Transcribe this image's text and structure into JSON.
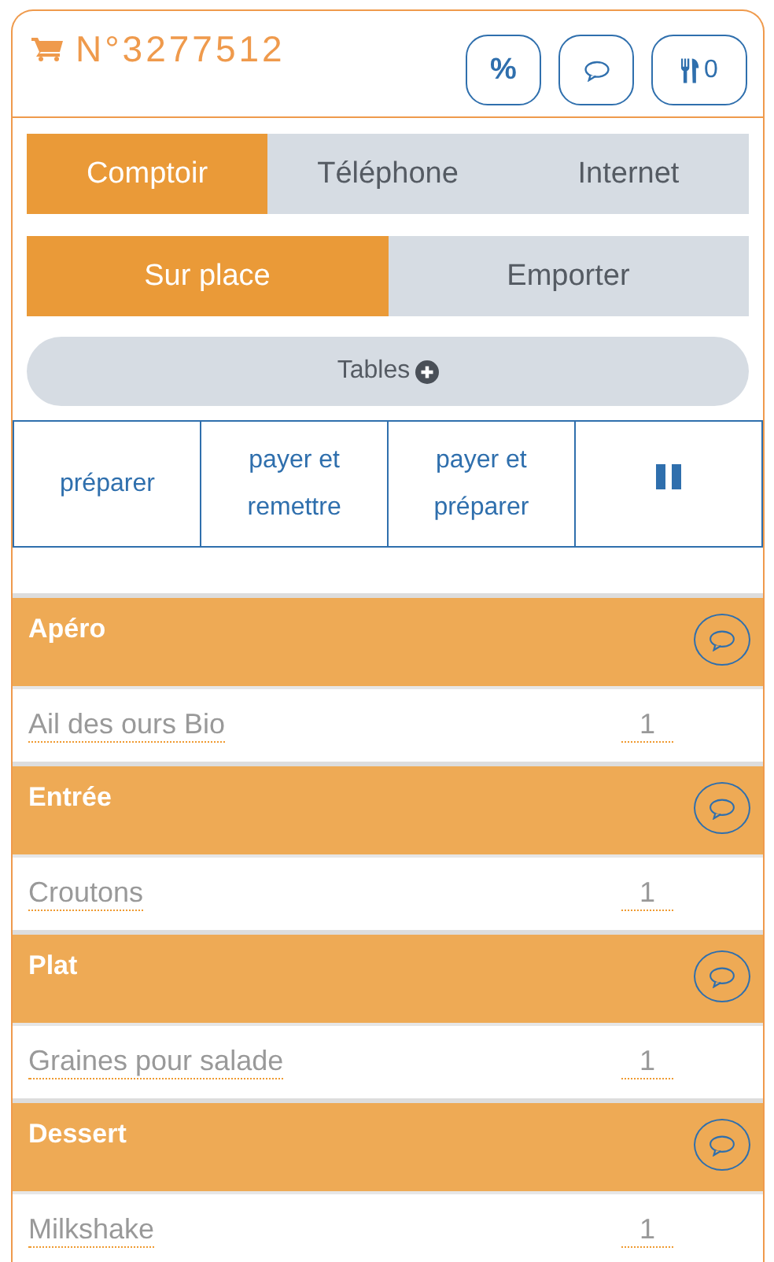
{
  "order": {
    "number": "N°3277512"
  },
  "header_buttons": [
    {
      "kind": "percent",
      "label": "%"
    },
    {
      "kind": "comment"
    },
    {
      "kind": "cutlery",
      "count": "0"
    }
  ],
  "channels": [
    {
      "label": "Comptoir",
      "selected": true
    },
    {
      "label": "Téléphone",
      "selected": false
    },
    {
      "label": "Internet",
      "selected": false
    }
  ],
  "modes": [
    {
      "label": "Sur place",
      "selected": true
    },
    {
      "label": "Emporter",
      "selected": false
    }
  ],
  "tables_button": {
    "label": "Tables"
  },
  "actions": [
    {
      "kind": "text",
      "label": "préparer"
    },
    {
      "kind": "text",
      "label": "payer et remettre"
    },
    {
      "kind": "text",
      "label": "payer et préparer"
    },
    {
      "kind": "pause"
    }
  ],
  "categories": [
    {
      "name": "Apéro",
      "items": [
        {
          "name": "Ail des ours Bio",
          "quantity": "1"
        }
      ]
    },
    {
      "name": "Entrée",
      "items": [
        {
          "name": "Croutons",
          "quantity": "1"
        }
      ]
    },
    {
      "name": "Plat",
      "items": [
        {
          "name": "Graines pour salade",
          "quantity": "1"
        }
      ]
    },
    {
      "name": "Dessert",
      "items": [
        {
          "name": "Milkshake",
          "quantity": "1"
        }
      ]
    }
  ]
}
